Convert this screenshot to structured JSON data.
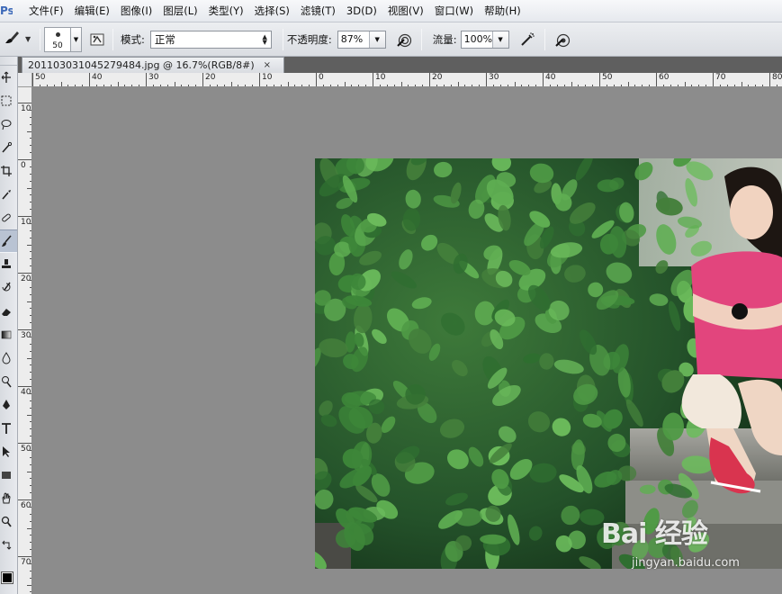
{
  "menubar": {
    "logo": "Ps",
    "items": [
      {
        "label": "文件(F)"
      },
      {
        "label": "编辑(E)"
      },
      {
        "label": "图像(I)"
      },
      {
        "label": "图层(L)"
      },
      {
        "label": "类型(Y)"
      },
      {
        "label": "选择(S)"
      },
      {
        "label": "滤镜(T)"
      },
      {
        "label": "3D(D)"
      },
      {
        "label": "视图(V)"
      },
      {
        "label": "窗口(W)"
      },
      {
        "label": "帮助(H)"
      }
    ]
  },
  "options": {
    "brush_size": "50",
    "mode_label": "模式:",
    "mode_value": "正常",
    "opacity_label": "不透明度:",
    "opacity_value": "87%",
    "flow_label": "流量:",
    "flow_value": "100%"
  },
  "document": {
    "tab_title": "20110303104527948​4.jpg @ 16.7%(RGB/8#)",
    "close_glyph": "×"
  },
  "rulers": {
    "horizontal_labels": [
      "50",
      "40",
      "30",
      "20",
      "10",
      "0",
      "10",
      "20",
      "30",
      "40",
      "50",
      "60",
      "70",
      "80"
    ],
    "vertical_labels": [
      "10",
      "0",
      "10",
      "20",
      "30",
      "40",
      "50",
      "60",
      "70"
    ]
  },
  "watermark": {
    "logo_text": "Bai 经验",
    "site_text": "jingyan.baidu.com"
  },
  "colors": {
    "foreground": "#000000",
    "workspace": "#8c8c8c",
    "accent": "#3b68b8"
  }
}
